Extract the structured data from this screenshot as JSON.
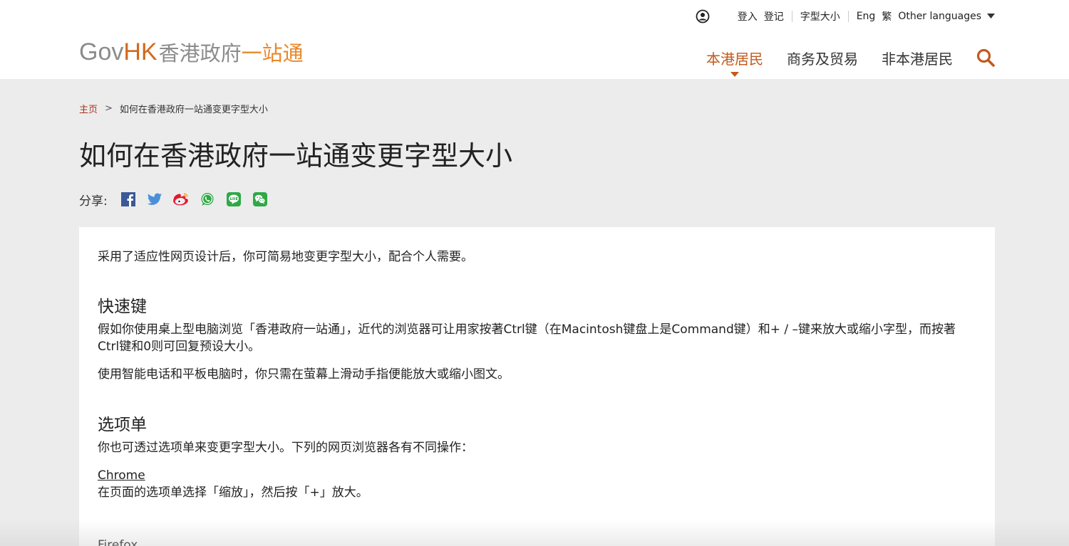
{
  "topbar": {
    "login": "登入",
    "register": "登记",
    "font_size": "字型大小",
    "eng": "Eng",
    "trad": "繁",
    "other_languages": "Other languages"
  },
  "logo": {
    "gov": "Gov",
    "hk": "HK",
    "xianggang_zhengfu": "香港政府",
    "yizhantong": "一站通"
  },
  "nav": {
    "items": [
      "本港居民",
      "商务及贸易",
      "非本港居民"
    ],
    "active": "本港居民"
  },
  "breadcrumb": {
    "home": "主页",
    "separator": ">",
    "current": "如何在香港政府一站通变更字型大小"
  },
  "page": {
    "title": "如何在香港政府一站通变更字型大小"
  },
  "share": {
    "label": "分享:",
    "icons": [
      "facebook-icon",
      "twitter-icon",
      "weibo-icon",
      "whatsapp-icon",
      "line-icon",
      "wechat-icon"
    ]
  },
  "content": {
    "intro": "采用了适应性网页设计后，你可简易地变更字型大小，配合个人需要。",
    "shortcut_heading": "快速键",
    "shortcut_p1": "假如你使用桌上型电脑浏览「香港政府一站通」，近代的浏览器可让用家按著Ctrl键（在Macintosh键盘上是Command键）和+ / –键来放大或缩小字型，而按著Ctrl键和0则可回复预设大小。",
    "shortcut_p2": "使用智能电话和平板电脑时，你只需在萤幕上滑动手指便能放大或缩小图文。",
    "menu_heading": "选项单",
    "menu_p1": "你也可透过选项单来变更字型大小。下列的网页浏览器各有不同操作：",
    "chrome_link": "Chrome",
    "chrome_text": "在页面的选项单选择「缩放」，然后按「+」放大。",
    "firefox_link": "Firefox"
  },
  "colors": {
    "accent": "#c25a1b",
    "breadcrumb_link": "#a8321c",
    "logo_orange": "#e8882a",
    "logo_gray": "#8c8c8c",
    "page_bg": "#ececec"
  }
}
